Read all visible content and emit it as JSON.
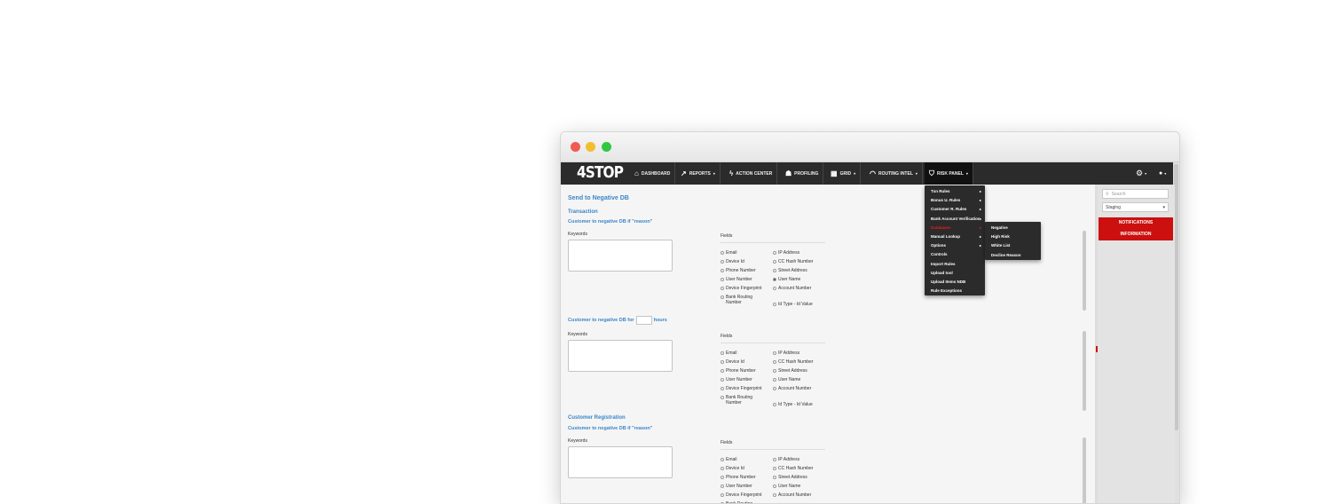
{
  "nav": {
    "logo": "4STOP",
    "items": [
      {
        "label": "DASHBOARD",
        "icon": "home-icon",
        "glyph": "⌂",
        "caret": ""
      },
      {
        "label": "REPORTS",
        "icon": "chart-icon",
        "glyph": "↗",
        "caret": "▾"
      },
      {
        "label": "ACTION CENTER",
        "icon": "bolt-icon",
        "glyph": "ϟ",
        "caret": ""
      },
      {
        "label": "PROFILING",
        "icon": "users-icon",
        "glyph": "☗",
        "caret": ""
      },
      {
        "label": "GRID",
        "icon": "grid-icon",
        "glyph": "▦",
        "caret": "▾"
      },
      {
        "label": "ROUTING INTEL",
        "icon": "wifi-icon",
        "glyph": "◠",
        "caret": "▾"
      },
      {
        "label": "RISK PANEL",
        "icon": "shield-icon",
        "glyph": "⛉",
        "caret": "▾"
      }
    ],
    "settings_icon": "⚙",
    "user_icon": "👤",
    "caret": "▾"
  },
  "risk_menu": [
    {
      "label": "Txn Rules",
      "arrow": "▸",
      "highlight": false
    },
    {
      "label": "Bonus U. Rules",
      "arrow": "▸",
      "highlight": false
    },
    {
      "label": "Customer R. Rules",
      "arrow": "▸",
      "highlight": false
    },
    {
      "label": "Bank Account Verification",
      "arrow": "▸",
      "highlight": false
    },
    {
      "label": "Databases",
      "arrow": "▸",
      "highlight": true
    },
    {
      "label": "Manual Lookup",
      "arrow": "▸",
      "highlight": false
    },
    {
      "label": "Options",
      "arrow": "▸",
      "highlight": false
    },
    {
      "label": "Controls",
      "arrow": "",
      "highlight": false
    },
    {
      "label": "Import Rules",
      "arrow": "",
      "highlight": false
    },
    {
      "label": "Upload tool",
      "arrow": "",
      "highlight": false
    },
    {
      "label": "Upload Items NDB",
      "arrow": "",
      "highlight": false
    },
    {
      "label": "Rule Exceptions",
      "arrow": "",
      "highlight": false
    }
  ],
  "databases_submenu": [
    "Negative",
    "High Risk",
    "White List",
    "Decline Reason"
  ],
  "page": {
    "title": "Send to Negative DB",
    "transaction": "Transaction",
    "rule_reason": "Customer to negative DB if \"reason\"",
    "rule_hours_prefix": "Customer to negative DB for",
    "rule_hours_suffix": "hours",
    "keywords": "Keywords",
    "fields": "Fields",
    "registration": "Customer Registration"
  },
  "fields_left": [
    "Email",
    "Device Id",
    "Phone Number",
    "User Number",
    "Device Fingerprint",
    "Bank Routing Number"
  ],
  "fields_right": [
    "IP Address",
    "CC Hash Number",
    "Street Address",
    "User Name",
    "Account Number",
    "Id Type - Id Value"
  ],
  "checked_right_first_block": "User Name",
  "sidebar": {
    "search_placeholder": "Search",
    "select_value": "Staging",
    "notifications_line1": "NOTIFICATIONS",
    "notifications_line2": "INFORMATION"
  },
  "colors": {
    "nav_bg": "#2b2b2b",
    "accent_blue": "#3a87c8",
    "alert_red": "#cc0f0f"
  }
}
